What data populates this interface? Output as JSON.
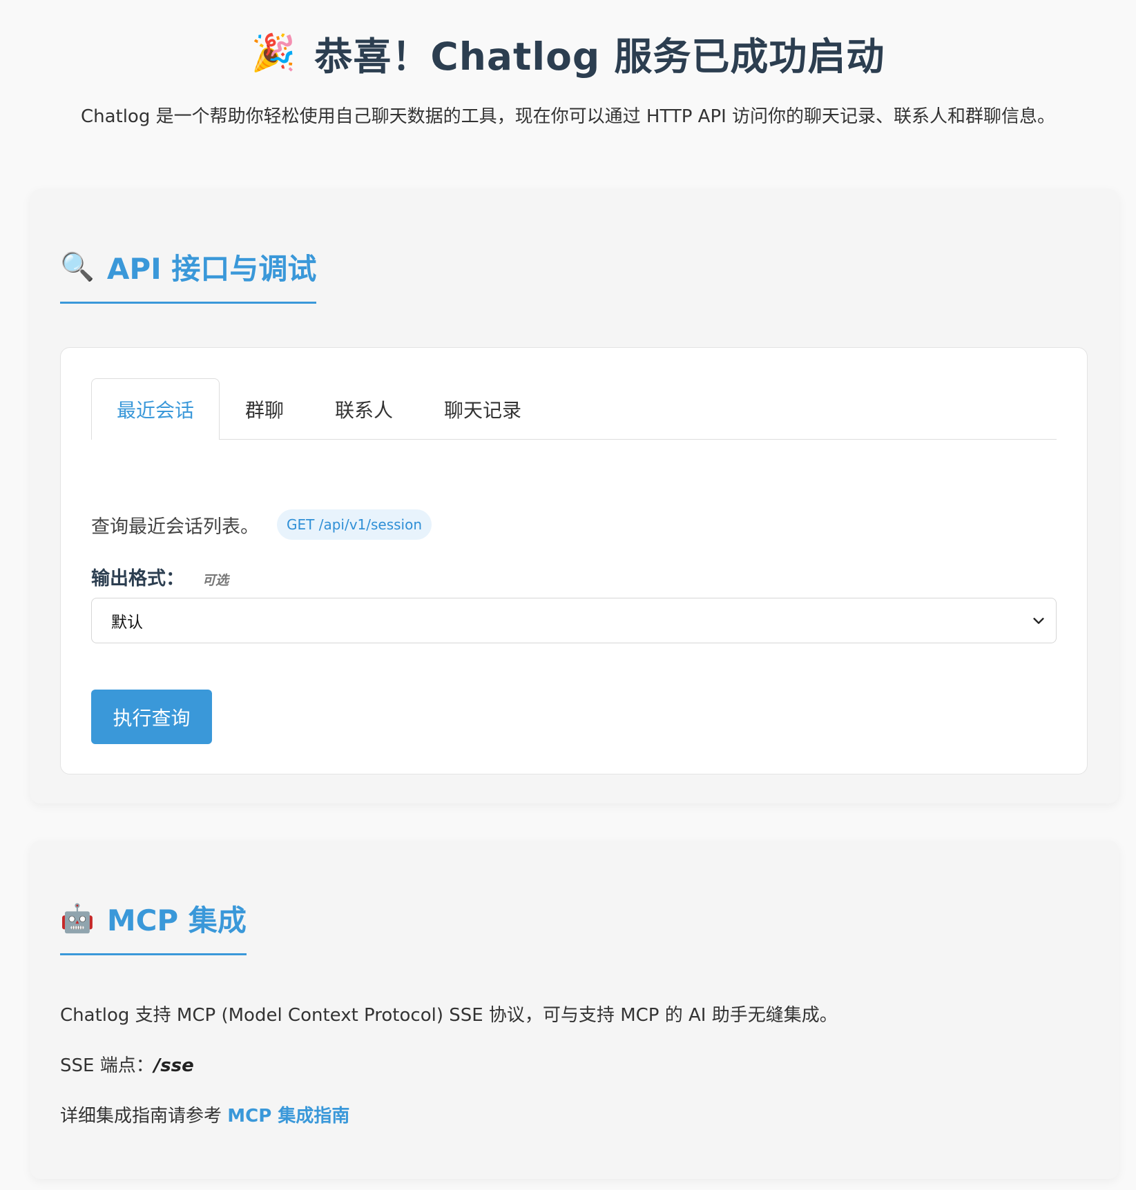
{
  "header": {
    "emoji": "🎉",
    "title": "恭喜！Chatlog 服务已成功启动",
    "description": "Chatlog 是一个帮助你轻松使用自己聊天数据的工具，现在你可以通过 HTTP API 访问你的聊天记录、联系人和群聊信息。"
  },
  "api_section": {
    "icon": "🔍",
    "title": "API 接口与调试",
    "tabs": [
      {
        "label": "最近会话",
        "active": true
      },
      {
        "label": "群聊",
        "active": false
      },
      {
        "label": "联系人",
        "active": false
      },
      {
        "label": "聊天记录",
        "active": false
      }
    ],
    "endpoint_description": "查询最近会话列表。",
    "endpoint_badge": "GET /api/v1/session",
    "format_label": "输出格式：",
    "format_optional": "可选",
    "format_selected": "默认",
    "run_button": "执行查询"
  },
  "mcp_section": {
    "icon": "🤖",
    "title": "MCP 集成",
    "intro": "Chatlog 支持 MCP (Model Context Protocol) SSE 协议，可与支持 MCP 的 AI 助手无缝集成。",
    "sse_label": "SSE 端点：",
    "sse_value": "/sse",
    "guide_prefix": "详细集成指南请参考 ",
    "guide_link": "MCP 集成指南"
  },
  "colors": {
    "accent": "#3a98d9",
    "heading_dark": "#2c3e50",
    "badge_bg": "#e8f3fc"
  }
}
